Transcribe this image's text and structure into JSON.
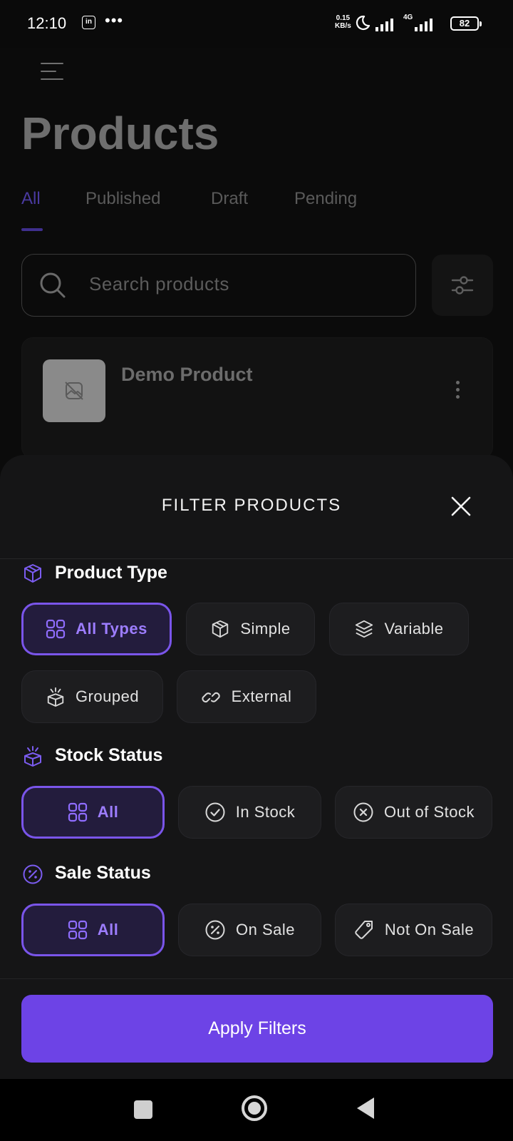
{
  "status_bar": {
    "time": "12:10",
    "app_badge": "in",
    "more": "•••",
    "net_speed_value": "0.15",
    "net_speed_unit": "KB/s",
    "network": "4G",
    "battery": "82"
  },
  "header": {
    "menu_icon": "hamburger-menu-icon",
    "title": "Products"
  },
  "tabs": [
    {
      "label": "All",
      "active": true
    },
    {
      "label": "Published",
      "active": false
    },
    {
      "label": "Draft",
      "active": false
    },
    {
      "label": "Pending",
      "active": false
    }
  ],
  "search": {
    "placeholder": "Search products",
    "icon": "search-icon",
    "filter_icon": "sliders-icon"
  },
  "product_list": [
    {
      "name": "Demo Product",
      "image": "image-placeholder-icon"
    }
  ],
  "filter_sheet": {
    "title": "FILTER PRODUCTS",
    "close_icon": "close-icon",
    "sections": {
      "product_type": {
        "title": "Product Type",
        "icon": "box-icon",
        "options": [
          {
            "label": "All Types",
            "icon": "grid-icon",
            "selected": true
          },
          {
            "label": "Simple",
            "icon": "box-icon",
            "selected": false
          },
          {
            "label": "Variable",
            "icon": "layers-icon",
            "selected": false
          },
          {
            "label": "Grouped",
            "icon": "box-open-icon",
            "selected": false
          },
          {
            "label": "External",
            "icon": "link-icon",
            "selected": false
          }
        ]
      },
      "stock_status": {
        "title": "Stock Status",
        "icon": "box-open-icon",
        "options": [
          {
            "label": "All",
            "icon": "grid-icon",
            "selected": true
          },
          {
            "label": "In Stock",
            "icon": "check-circle-icon",
            "selected": false
          },
          {
            "label": "Out of Stock",
            "icon": "x-circle-icon",
            "selected": false
          }
        ]
      },
      "sale_status": {
        "title": "Sale Status",
        "icon": "percent-circle-icon",
        "options": [
          {
            "label": "All",
            "icon": "grid-icon",
            "selected": true
          },
          {
            "label": "On Sale",
            "icon": "percent-circle-icon",
            "selected": false
          },
          {
            "label": "Not On Sale",
            "icon": "tag-icon",
            "selected": false
          }
        ]
      }
    },
    "apply_label": "Apply Filters"
  },
  "colors": {
    "accent": "#6d43e6",
    "selected_border": "#7a55ea",
    "selected_text": "#9d7dff",
    "sheet_bg": "#151516",
    "chip_bg": "#1d1d1f"
  }
}
